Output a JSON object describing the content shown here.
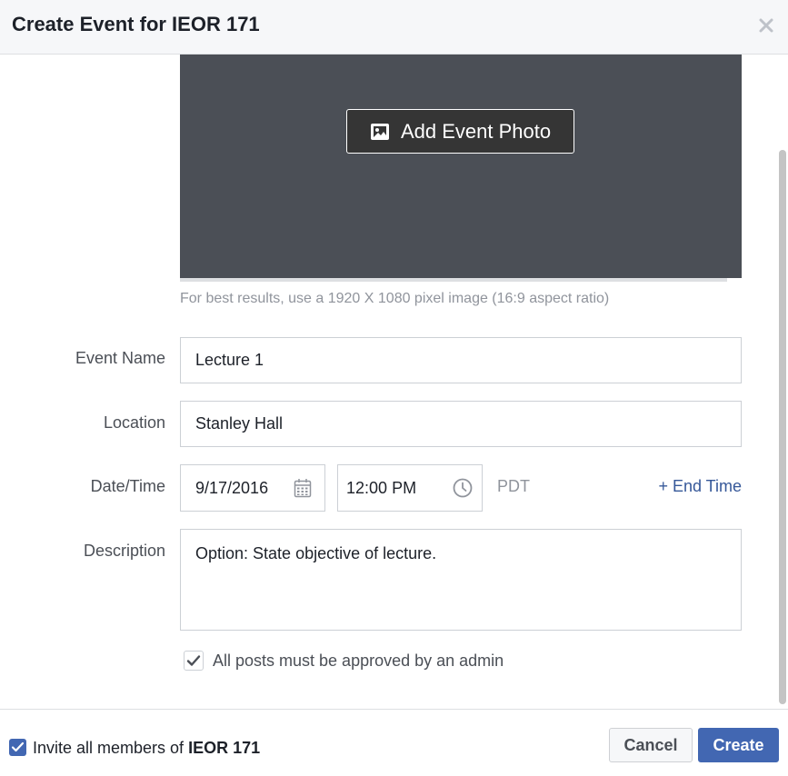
{
  "dialog": {
    "title": "Create Event for IEOR 171"
  },
  "photo": {
    "button_label": "Add Event Photo",
    "hint": "For best results, use a 1920 X 1080 pixel image (16:9 aspect ratio)"
  },
  "form": {
    "event_name": {
      "label": "Event Name",
      "value": "Lecture 1"
    },
    "location": {
      "label": "Location",
      "value": "Stanley Hall"
    },
    "datetime": {
      "label": "Date/Time",
      "date": "9/17/2016",
      "time_hour": "12",
      "time_minute": "00",
      "time_ampm": "PM",
      "timezone": "PDT",
      "end_time_link": "+ End Time"
    },
    "description": {
      "label": "Description",
      "value": "Option: State objective of lecture."
    },
    "approval": {
      "label": "All posts must be approved by an admin",
      "checked": true
    }
  },
  "footer": {
    "invite_prefix": "Invite all members of ",
    "invite_group": "IEOR 171",
    "invite_checked": true,
    "cancel_label": "Cancel",
    "create_label": "Create"
  },
  "colors": {
    "accent": "#4267b2",
    "link": "#365899",
    "photo_bg": "#4b4f56"
  }
}
